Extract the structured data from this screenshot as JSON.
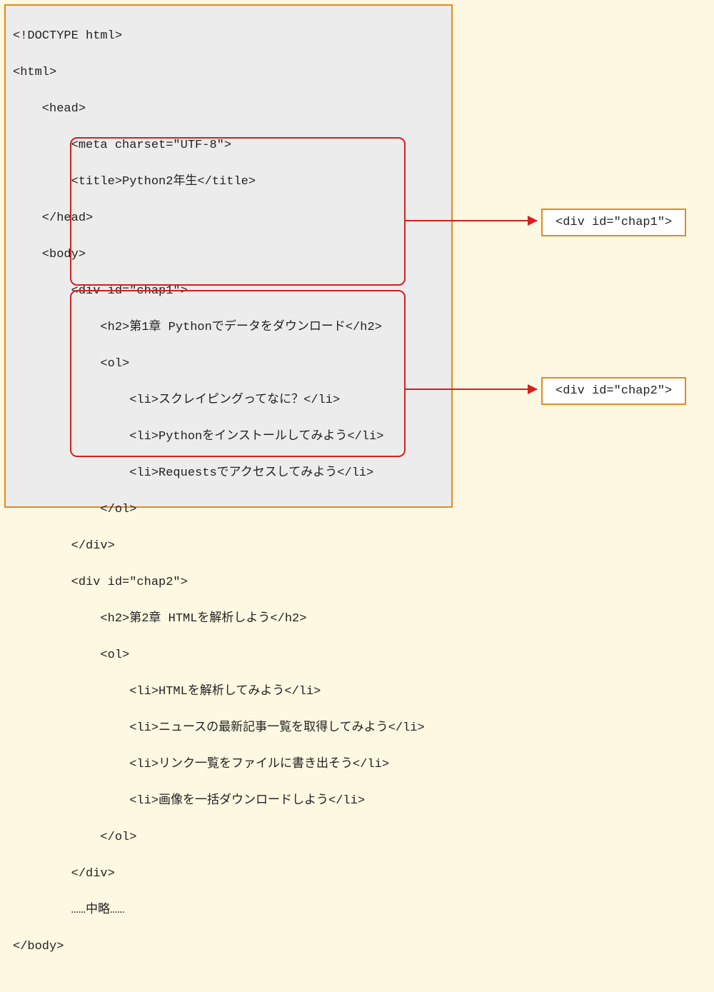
{
  "code": {
    "l1": "<!DOCTYPE html>",
    "l2": "<html>",
    "l3": "    <head>",
    "l4": "        <meta charset=\"UTF-8\">",
    "l5": "        <title>Python2年生</title>",
    "l6": "    </head>",
    "l7": "    <body>",
    "l8": "        <div id=\"chap1\">",
    "l9": "            <h2>第1章 Pythonでデータをダウンロード</h2>",
    "l10": "            <ol>",
    "l11": "                <li>スクレイピングってなに？</li>",
    "l12": "                <li>Pythonをインストールしてみよう</li>",
    "l13": "                <li>Requestsでアクセスしてみよう</li>",
    "l14": "            </ol>",
    "l15": "        </div>",
    "l16": "        <div id=\"chap2\">",
    "l17": "            <h2>第2章 HTMLを解析しよう</h2>",
    "l18": "            <ol>",
    "l19": "                <li>HTMLを解析してみよう</li>",
    "l20": "                <li>ニュースの最新記事一覧を取得してみよう</li>",
    "l21": "                <li>リンク一覧をファイルに書き出そう</li>",
    "l22": "                <li>画像を一括ダウンロードしよう</li>",
    "l23": "            </ol>",
    "l24": "        </div>",
    "l25": "        ……中略……",
    "l26": "</body>"
  },
  "callouts": {
    "c1": "<div id=\"chap1\">",
    "c2": "<div id=\"chap2\">"
  }
}
